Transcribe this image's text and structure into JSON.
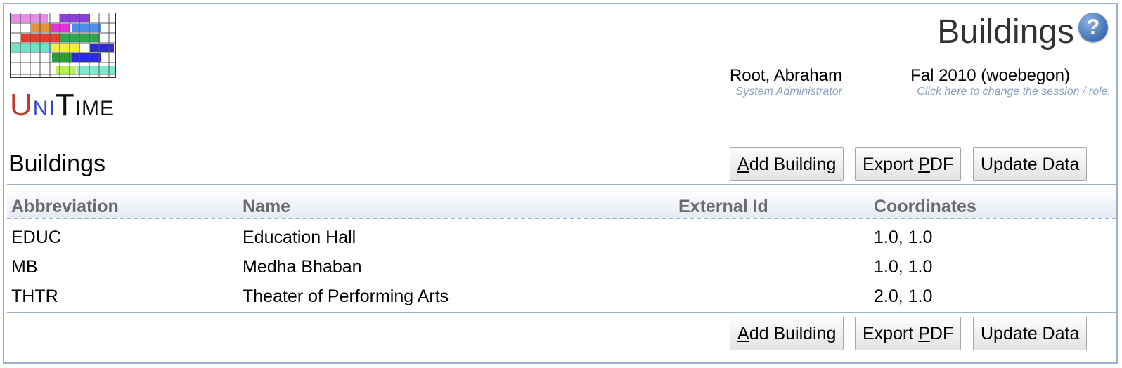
{
  "logo": {
    "u": "U",
    "ni": "NI",
    "t": "T",
    "ime": "IME"
  },
  "header": {
    "page_title": "Buildings",
    "help_icon": "?",
    "user_name": "Root, Abraham",
    "user_role": "System Administrator",
    "session_name": "Fal 2010 (woebegon)",
    "session_hint": "Click here to change the session / role."
  },
  "section": {
    "title": "Buildings"
  },
  "buttons": {
    "add_first": "A",
    "add_rest": "dd Building",
    "export_pre": "Export ",
    "export_ul": "P",
    "export_post": "DF",
    "update": "Update Data"
  },
  "table": {
    "columns": [
      "Abbreviation",
      "Name",
      "External Id",
      "Coordinates"
    ],
    "rows": [
      {
        "abbreviation": "EDUC",
        "name": "Education Hall",
        "external_id": "",
        "coordinates": "1.0, 1.0"
      },
      {
        "abbreviation": "MB",
        "name": "Medha Bhaban",
        "external_id": "",
        "coordinates": "1.0, 1.0"
      },
      {
        "abbreviation": "THTR",
        "name": "Theater of Performing Arts",
        "external_id": "",
        "coordinates": "2.0, 1.0"
      }
    ]
  },
  "colors": {
    "border": "#9cb0ce",
    "hint": "#8a9fc0",
    "header_text": "#6b6b6b"
  },
  "icons": {
    "logo": "unitime-logo-icon",
    "help": "help-icon"
  }
}
